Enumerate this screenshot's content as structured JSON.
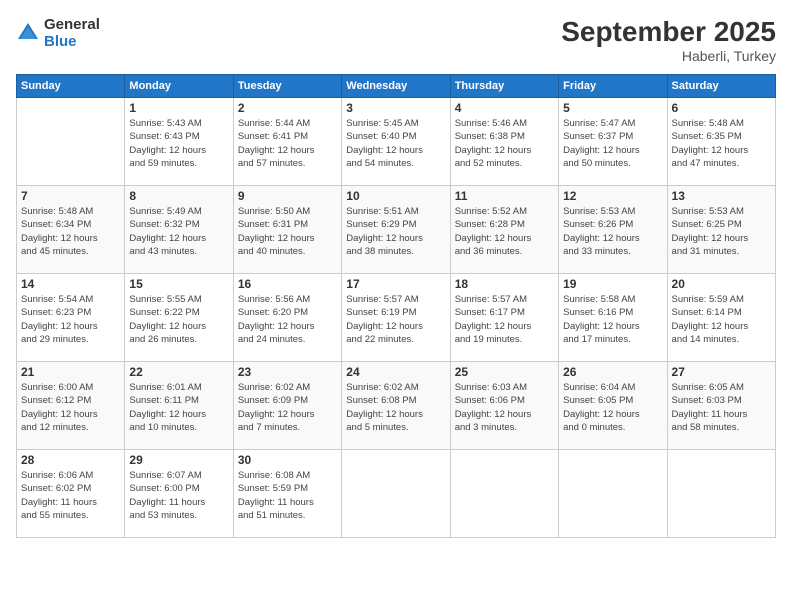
{
  "logo": {
    "line1": "General",
    "line2": "Blue"
  },
  "header": {
    "month": "September 2025",
    "location": "Haberli, Turkey"
  },
  "weekdays": [
    "Sunday",
    "Monday",
    "Tuesday",
    "Wednesday",
    "Thursday",
    "Friday",
    "Saturday"
  ],
  "weeks": [
    [
      {
        "day": "",
        "info": ""
      },
      {
        "day": "1",
        "info": "Sunrise: 5:43 AM\nSunset: 6:43 PM\nDaylight: 12 hours\nand 59 minutes."
      },
      {
        "day": "2",
        "info": "Sunrise: 5:44 AM\nSunset: 6:41 PM\nDaylight: 12 hours\nand 57 minutes."
      },
      {
        "day": "3",
        "info": "Sunrise: 5:45 AM\nSunset: 6:40 PM\nDaylight: 12 hours\nand 54 minutes."
      },
      {
        "day": "4",
        "info": "Sunrise: 5:46 AM\nSunset: 6:38 PM\nDaylight: 12 hours\nand 52 minutes."
      },
      {
        "day": "5",
        "info": "Sunrise: 5:47 AM\nSunset: 6:37 PM\nDaylight: 12 hours\nand 50 minutes."
      },
      {
        "day": "6",
        "info": "Sunrise: 5:48 AM\nSunset: 6:35 PM\nDaylight: 12 hours\nand 47 minutes."
      }
    ],
    [
      {
        "day": "7",
        "info": "Sunrise: 5:48 AM\nSunset: 6:34 PM\nDaylight: 12 hours\nand 45 minutes."
      },
      {
        "day": "8",
        "info": "Sunrise: 5:49 AM\nSunset: 6:32 PM\nDaylight: 12 hours\nand 43 minutes."
      },
      {
        "day": "9",
        "info": "Sunrise: 5:50 AM\nSunset: 6:31 PM\nDaylight: 12 hours\nand 40 minutes."
      },
      {
        "day": "10",
        "info": "Sunrise: 5:51 AM\nSunset: 6:29 PM\nDaylight: 12 hours\nand 38 minutes."
      },
      {
        "day": "11",
        "info": "Sunrise: 5:52 AM\nSunset: 6:28 PM\nDaylight: 12 hours\nand 36 minutes."
      },
      {
        "day": "12",
        "info": "Sunrise: 5:53 AM\nSunset: 6:26 PM\nDaylight: 12 hours\nand 33 minutes."
      },
      {
        "day": "13",
        "info": "Sunrise: 5:53 AM\nSunset: 6:25 PM\nDaylight: 12 hours\nand 31 minutes."
      }
    ],
    [
      {
        "day": "14",
        "info": "Sunrise: 5:54 AM\nSunset: 6:23 PM\nDaylight: 12 hours\nand 29 minutes."
      },
      {
        "day": "15",
        "info": "Sunrise: 5:55 AM\nSunset: 6:22 PM\nDaylight: 12 hours\nand 26 minutes."
      },
      {
        "day": "16",
        "info": "Sunrise: 5:56 AM\nSunset: 6:20 PM\nDaylight: 12 hours\nand 24 minutes."
      },
      {
        "day": "17",
        "info": "Sunrise: 5:57 AM\nSunset: 6:19 PM\nDaylight: 12 hours\nand 22 minutes."
      },
      {
        "day": "18",
        "info": "Sunrise: 5:57 AM\nSunset: 6:17 PM\nDaylight: 12 hours\nand 19 minutes."
      },
      {
        "day": "19",
        "info": "Sunrise: 5:58 AM\nSunset: 6:16 PM\nDaylight: 12 hours\nand 17 minutes."
      },
      {
        "day": "20",
        "info": "Sunrise: 5:59 AM\nSunset: 6:14 PM\nDaylight: 12 hours\nand 14 minutes."
      }
    ],
    [
      {
        "day": "21",
        "info": "Sunrise: 6:00 AM\nSunset: 6:12 PM\nDaylight: 12 hours\nand 12 minutes."
      },
      {
        "day": "22",
        "info": "Sunrise: 6:01 AM\nSunset: 6:11 PM\nDaylight: 12 hours\nand 10 minutes."
      },
      {
        "day": "23",
        "info": "Sunrise: 6:02 AM\nSunset: 6:09 PM\nDaylight: 12 hours\nand 7 minutes."
      },
      {
        "day": "24",
        "info": "Sunrise: 6:02 AM\nSunset: 6:08 PM\nDaylight: 12 hours\nand 5 minutes."
      },
      {
        "day": "25",
        "info": "Sunrise: 6:03 AM\nSunset: 6:06 PM\nDaylight: 12 hours\nand 3 minutes."
      },
      {
        "day": "26",
        "info": "Sunrise: 6:04 AM\nSunset: 6:05 PM\nDaylight: 12 hours\nand 0 minutes."
      },
      {
        "day": "27",
        "info": "Sunrise: 6:05 AM\nSunset: 6:03 PM\nDaylight: 11 hours\nand 58 minutes."
      }
    ],
    [
      {
        "day": "28",
        "info": "Sunrise: 6:06 AM\nSunset: 6:02 PM\nDaylight: 11 hours\nand 55 minutes."
      },
      {
        "day": "29",
        "info": "Sunrise: 6:07 AM\nSunset: 6:00 PM\nDaylight: 11 hours\nand 53 minutes."
      },
      {
        "day": "30",
        "info": "Sunrise: 6:08 AM\nSunset: 5:59 PM\nDaylight: 11 hours\nand 51 minutes."
      },
      {
        "day": "",
        "info": ""
      },
      {
        "day": "",
        "info": ""
      },
      {
        "day": "",
        "info": ""
      },
      {
        "day": "",
        "info": ""
      }
    ]
  ]
}
